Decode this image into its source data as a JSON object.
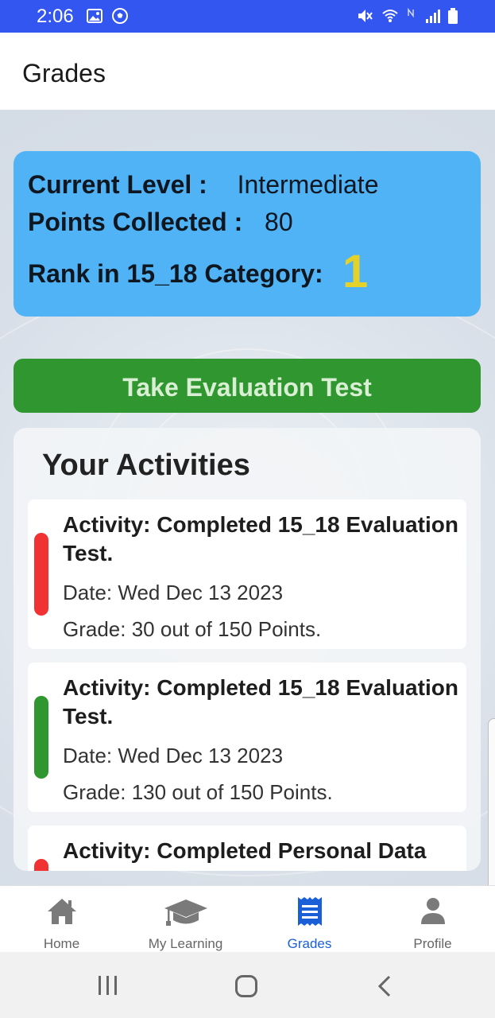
{
  "status_bar": {
    "time": "2:06"
  },
  "app_bar": {
    "title": "Grades"
  },
  "level_card": {
    "current_level_label": "Current Level :",
    "current_level_value": "Intermediate",
    "points_label": "Points Collected :",
    "points_value": "80",
    "rank_label": "Rank in 15_18 Category:",
    "rank_value": "1"
  },
  "evaluation_button": {
    "label": "Take Evaluation Test"
  },
  "activities": {
    "heading": "Your Activities",
    "items": [
      {
        "title": "Activity: Completed 15_18 Evaluation Test.",
        "date": "Date: Wed Dec 13 2023",
        "grade": "Grade: 30 out of 150 Points.",
        "indicator_color": "#f03232"
      },
      {
        "title": "Activity: Completed 15_18 Evaluation Test.",
        "date": "Date: Wed Dec 13 2023",
        "grade": "Grade: 130 out of 150 Points.",
        "indicator_color": "#2f9630"
      },
      {
        "title": "Activity: Completed Personal Data",
        "indicator_color": "#f03232"
      }
    ]
  },
  "bottom_nav": {
    "items": [
      {
        "label": "Home",
        "icon": "home-icon"
      },
      {
        "label": "My Learning",
        "icon": "graduation-cap-icon"
      },
      {
        "label": "Grades",
        "icon": "receipt-icon",
        "active": true
      },
      {
        "label": "Profile",
        "icon": "person-icon"
      }
    ]
  },
  "colors": {
    "status_bar": "#3355f0",
    "level_card": "#50b3f5",
    "button": "#2f9630",
    "rank": "#e4d22b",
    "active_nav": "#1a5fd8"
  }
}
